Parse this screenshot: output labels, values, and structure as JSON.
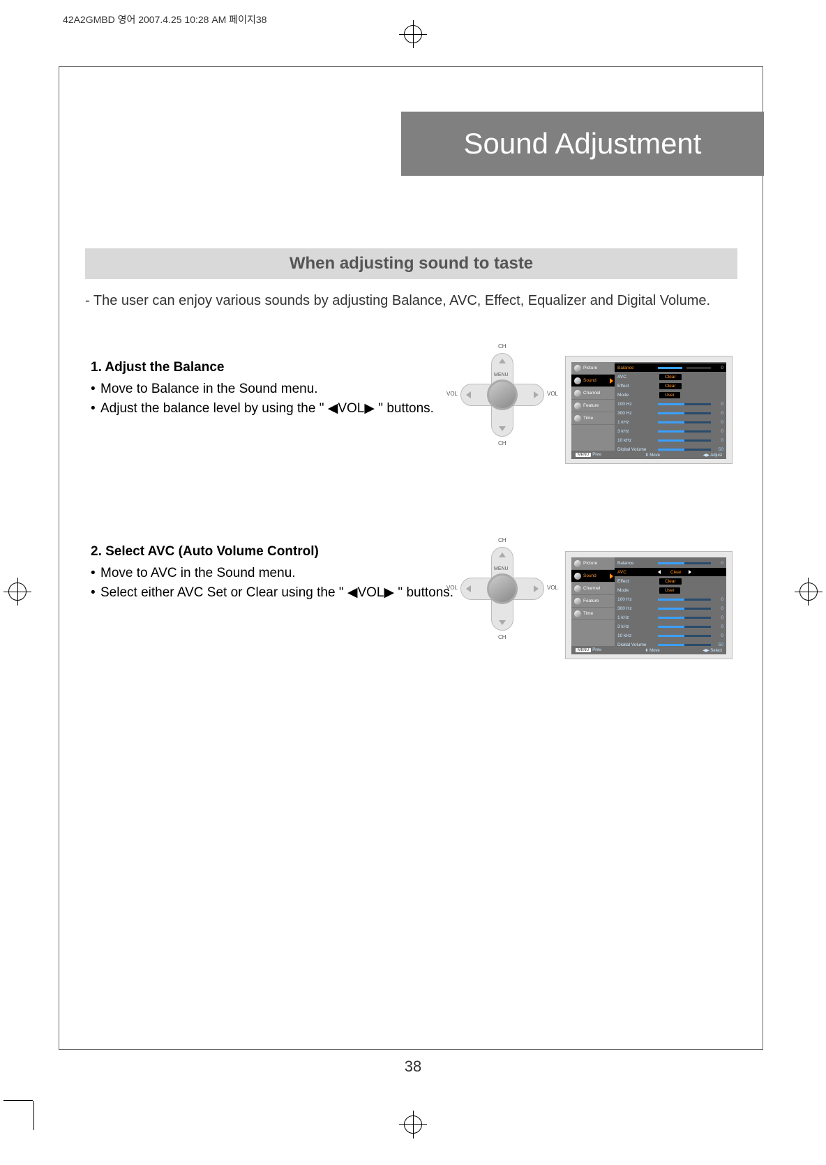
{
  "meta_header": "42A2GMBD 영어 2007.4.25 10:28 AM 페이지38",
  "title": "Sound Adjustment",
  "subtitle": "When adjusting sound to taste",
  "intro": "- The user can enjoy various sounds by adjusting Balance, AVC, Effect, Equalizer and Digital Volume.",
  "section1": {
    "heading": "1. Adjust the Balance",
    "line1": "Move to Balance in the Sound menu.",
    "line2a": "Adjust the balance level by using the \"",
    "line2b": "VOL",
    "line2c": "\" buttons."
  },
  "section2": {
    "heading": "2. Select AVC (Auto Volume Control)",
    "line1": "Move to AVC in the Sound menu.",
    "line2a": "Select either AVC Set or Clear using the \"",
    "line2b": "VOL",
    "line2c": "\" buttons."
  },
  "dpad": {
    "top": "CH",
    "bottom": "CH",
    "left": "VOL",
    "right": "VOL",
    "menu": "MENU"
  },
  "osd_left": {
    "items": [
      "Picture",
      "Sound",
      "Channel",
      "Feature",
      "Time"
    ],
    "active_index": 1
  },
  "osd1_rows": [
    {
      "label": "Balance",
      "type": "slider-knob",
      "value": "0",
      "highlight": true,
      "fill": 50
    },
    {
      "label": "AVC",
      "type": "chip",
      "chip": "Clear"
    },
    {
      "label": "Effect",
      "type": "chip",
      "chip": "Clear"
    },
    {
      "label": "Mode",
      "type": "chip",
      "chip": "User"
    },
    {
      "label": "100 Hz",
      "type": "slider",
      "value": "0",
      "fill": 50
    },
    {
      "label": "300 Hz",
      "type": "slider",
      "value": "0",
      "fill": 50
    },
    {
      "label": "1 kHz",
      "type": "slider",
      "value": "0",
      "fill": 50
    },
    {
      "label": "3 kHz",
      "type": "slider",
      "value": "0",
      "fill": 50
    },
    {
      "label": "10 kHz",
      "type": "slider",
      "value": "0",
      "fill": 50
    },
    {
      "label": "Digital Volume",
      "type": "slider",
      "value": "50",
      "fill": 50
    }
  ],
  "osd1_foot": {
    "btn": "MENU",
    "l": "Prev.",
    "c": "Move",
    "r": "Adjust"
  },
  "osd2_rows": [
    {
      "label": "Balance",
      "type": "slider",
      "value": "0",
      "fill": 50
    },
    {
      "label": "AVC",
      "type": "chip-sel",
      "chip": "Clear",
      "highlight": true
    },
    {
      "label": "Effect",
      "type": "chip",
      "chip": "Clear"
    },
    {
      "label": "Mode",
      "type": "chip",
      "chip": "User"
    },
    {
      "label": "100 Hz",
      "type": "slider",
      "value": "0",
      "fill": 50
    },
    {
      "label": "300 Hz",
      "type": "slider",
      "value": "0",
      "fill": 50
    },
    {
      "label": "1 kHz",
      "type": "slider",
      "value": "0",
      "fill": 50
    },
    {
      "label": "3 kHz",
      "type": "slider",
      "value": "0",
      "fill": 50
    },
    {
      "label": "10 kHz",
      "type": "slider",
      "value": "0",
      "fill": 50
    },
    {
      "label": "Digital Volume",
      "type": "slider",
      "value": "50",
      "fill": 50
    }
  ],
  "osd2_foot": {
    "btn": "MENU",
    "l": "Prev.",
    "c": "Move",
    "r": "Select"
  },
  "page_number": "38"
}
